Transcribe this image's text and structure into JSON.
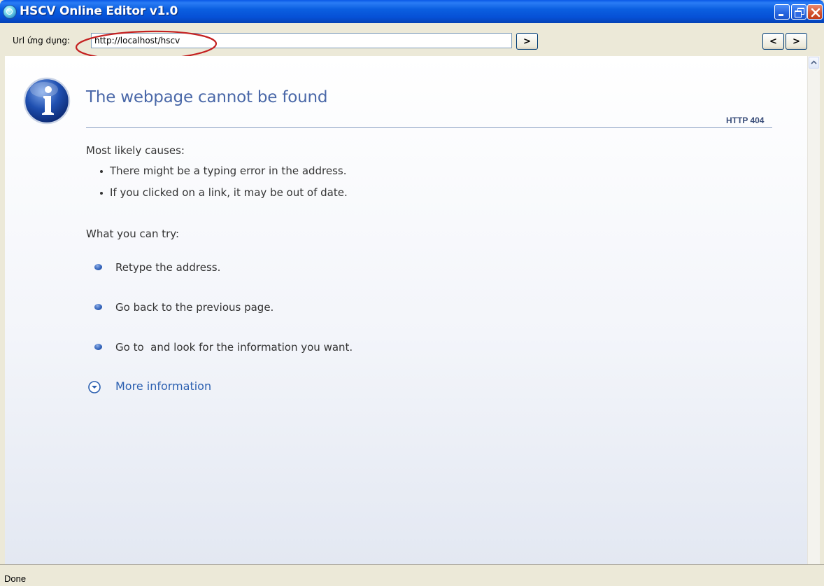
{
  "window": {
    "title": "HSCV Online Editor v1.0",
    "controls": [
      "minimize",
      "restore",
      "close"
    ]
  },
  "toolbar": {
    "url_label": "Url ứng dụng:",
    "url_value": "http://localhost/hscv",
    "go_label": ">",
    "back_label": "<",
    "forward_label": ">"
  },
  "page": {
    "heading": "The webpage cannot be found",
    "error_code": "HTTP 404",
    "causes_title": "Most likely causes:",
    "causes": [
      "There might be a typing error in the address.",
      "If you clicked on a link, it may be out of date."
    ],
    "try_title": "What you can try:",
    "try_items": [
      "Retype the address.",
      "Go back to the previous page.",
      "Go to  and look for the information you want."
    ],
    "more_info": "More information"
  },
  "status": {
    "text": "Done"
  },
  "colors": {
    "title_bar": "#0a58e6",
    "heading": "#4a68a8",
    "link": "#2b5fb0",
    "annotation_circle": "#c42020"
  },
  "icons": [
    "app-icon",
    "info-icon",
    "bullet-icon",
    "expand-chevron-icon",
    "scroll-up-arrow-icon"
  ]
}
